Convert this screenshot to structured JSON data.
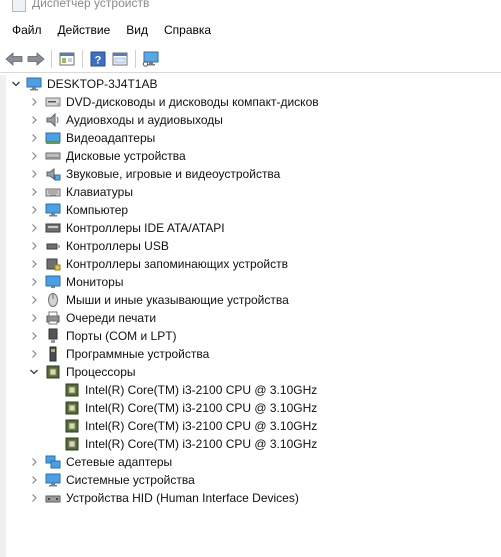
{
  "window": {
    "title": "Диспетчер устройств"
  },
  "menu": [
    "Файл",
    "Действие",
    "Вид",
    "Справка"
  ],
  "tree": {
    "root": "DESKTOP-3J4T1AB",
    "categories": [
      "DVD-дисководы и дисководы компакт-дисков",
      "Аудиовходы и аудиовыходы",
      "Видеоадаптеры",
      "Дисковые устройства",
      "Звуковые, игровые и видеоустройства",
      "Клавиатуры",
      "Компьютер",
      "Контроллеры IDE ATA/ATAPI",
      "Контроллеры USB",
      "Контроллеры запоминающих устройств",
      "Мониторы",
      "Мыши и иные указывающие устройства",
      "Очереди печати",
      "Порты (COM и LPT)",
      "Программные устройства",
      "Процессоры",
      "Сетевые адаптеры",
      "Системные устройства",
      "Устройства HID (Human Interface Devices)"
    ],
    "processors": [
      "Intel(R) Core(TM) i3-2100 CPU @ 3.10GHz",
      "Intel(R) Core(TM) i3-2100 CPU @ 3.10GHz",
      "Intel(R) Core(TM) i3-2100 CPU @ 3.10GHz",
      "Intel(R) Core(TM) i3-2100 CPU @ 3.10GHz"
    ]
  },
  "colors": {
    "accent": "#2b79d6",
    "chevron": "#5a5a5a"
  }
}
